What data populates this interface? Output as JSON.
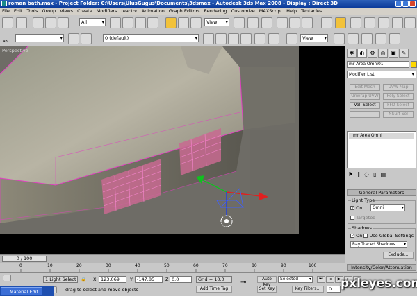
{
  "window": {
    "title": "roman bath.max - Project Folder: C:\\Users\\UlusGugus\\Documents\\3dsmax     - Autodesk 3ds Max 2008     - Display : Direct 3D"
  },
  "menu": [
    "File",
    "Edit",
    "Tools",
    "Group",
    "Views",
    "Create",
    "Modifiers",
    "reactor",
    "Animation",
    "Graph Editors",
    "Rendering",
    "Customize",
    "MAXScript",
    "Help",
    "Tentacles"
  ],
  "toolbar": {
    "selection_filter": "All",
    "ref_coord": "View",
    "ref_coord2": "View",
    "layer": "0 (default)",
    "named_sel_label": "ABC"
  },
  "viewport": {
    "label": "Perspective"
  },
  "command_panel": {
    "object_name": "mr Area Omni01",
    "modifier_list": "Modifier List",
    "mod_buttons": [
      {
        "label": "Edit Mesh",
        "enabled": false
      },
      {
        "label": "UVW Map",
        "enabled": false
      },
      {
        "label": "Unwrap UVW",
        "enabled": false
      },
      {
        "label": "Poly Select",
        "enabled": false
      },
      {
        "label": "Vol. Select",
        "enabled": true
      },
      {
        "label": "FFD Select",
        "enabled": false
      },
      {
        "label": "",
        "enabled": false
      },
      {
        "label": "NSurf Sel",
        "enabled": false
      }
    ],
    "stack_item": "mr Area Omni",
    "rollout_general": "General Parameters",
    "light_type_group": "Light Type",
    "light_on_label": "On",
    "light_type_value": "Omni",
    "targeted_label": "Targeted",
    "shadows_group": "Shadows",
    "shadow_on_label": "On",
    "use_global_label": "Use Global Settings",
    "shadow_type": "Ray Traced Shadows",
    "exclude_label": "Exclude...",
    "rollout_intensity": "Intensity/Color/Attenuation"
  },
  "timeline": {
    "slider_text": "0 / 100",
    "ticks": [
      "0",
      "10",
      "20",
      "30",
      "40",
      "50",
      "60",
      "70",
      "80",
      "90",
      "100"
    ]
  },
  "status": {
    "selection": "1 Light Select",
    "x_label": "X",
    "x_value": "123.069",
    "y_label": "Y",
    "y_value": "-147.85",
    "z_label": "Z",
    "z_value": "0.0",
    "grid": "Grid = 10.0",
    "auto_key": "Auto Key",
    "auto_key_value": "Selected",
    "set_key": "Set Key",
    "key_filters": "Key Filters...",
    "frame_value": "0",
    "prompt": "drag to select and move objects",
    "add_time_tag": "Add Time Tag"
  },
  "taskbar": {
    "item": "Material Edit"
  },
  "watermark": "pxleyes.com",
  "colors": {
    "selection_pink": "#e040c0",
    "object_swatch": "#ffd800"
  }
}
